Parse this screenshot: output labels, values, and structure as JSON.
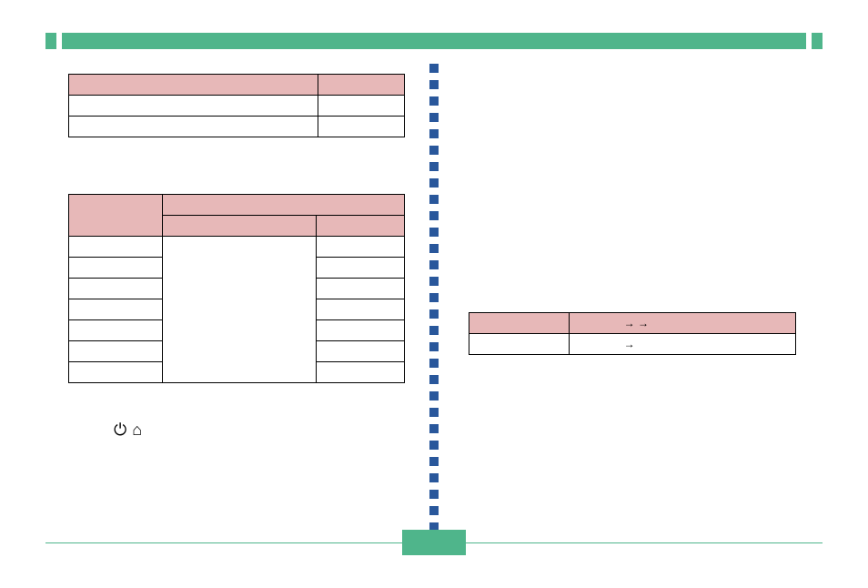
{
  "colors": {
    "accent_green": "#4fb58b",
    "header_pink": "#e7b8b8",
    "dot_blue": "#29579b"
  },
  "page_number": "",
  "table1": {
    "header": {
      "col1": "",
      "col2": ""
    },
    "rows": [
      {
        "col1": "",
        "col2": ""
      },
      {
        "col1": "",
        "col2": ""
      }
    ]
  },
  "table2": {
    "header_top": {
      "col1": "",
      "col_span": ""
    },
    "header_sub": {
      "col2": "",
      "col3": ""
    },
    "rows": [
      {
        "col1": "",
        "col2": "",
        "col3": ""
      },
      {
        "col1": "",
        "col3": ""
      },
      {
        "col1": "",
        "col3": ""
      },
      {
        "col1": "",
        "col3": ""
      },
      {
        "col1": "",
        "col3": ""
      },
      {
        "col1": "",
        "col3": ""
      },
      {
        "col1": "",
        "col3": ""
      }
    ]
  },
  "table3": {
    "header": {
      "col1": "",
      "col2": "→           →"
    },
    "rows": [
      {
        "col1": "",
        "col2": "→"
      }
    ]
  },
  "icon_row": {
    "icon1": "power-icon",
    "icon2": "home-icon"
  }
}
